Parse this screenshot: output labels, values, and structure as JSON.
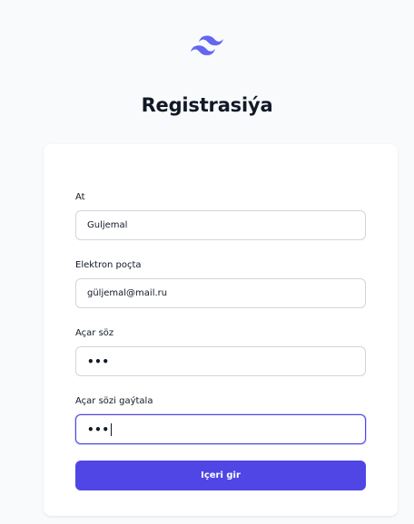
{
  "header": {
    "logo_icon": "tailwind-wave-logo",
    "title": "Registrasiýa"
  },
  "form": {
    "fields": [
      {
        "label": "At",
        "value": "Guljemal"
      },
      {
        "label": "Elektron poçta",
        "value": "güljemal@mail.ru"
      },
      {
        "label": "Açar söz",
        "value": "•••"
      },
      {
        "label": "Açar sözi gaýtala",
        "value": "•••"
      }
    ],
    "submit_label": "Içeri gir"
  },
  "colors": {
    "accent": "#4f46e5",
    "logo": "#6366f1",
    "page_background": "#f9fafb",
    "card_background": "#ffffff"
  }
}
